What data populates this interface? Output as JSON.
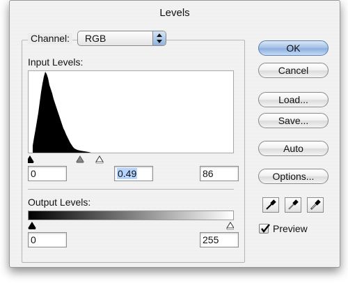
{
  "window": {
    "title": "Levels"
  },
  "channel": {
    "label": "Channel:",
    "value": "RGB"
  },
  "input_levels": {
    "label": "Input Levels:",
    "black": "0",
    "gamma": "0.49",
    "white": "86"
  },
  "output_levels": {
    "label": "Output Levels:",
    "black": "0",
    "white": "255"
  },
  "buttons": {
    "ok": "OK",
    "cancel": "Cancel",
    "load": "Load...",
    "save": "Save...",
    "auto": "Auto",
    "options": "Options..."
  },
  "eyedroppers": [
    "black-eyedropper-icon",
    "gray-eyedropper-icon",
    "white-eyedropper-icon"
  ],
  "preview": {
    "label": "Preview",
    "checked": true
  },
  "colors": {
    "dialog_bg": "#ececec",
    "default_button": "#a9c3e6",
    "selected_text": "#b5d5ff"
  }
}
